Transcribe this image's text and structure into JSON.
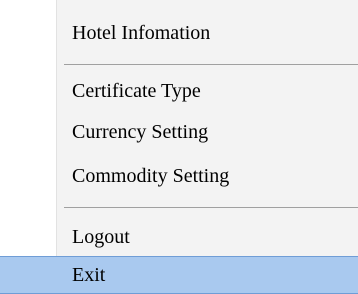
{
  "menu": {
    "items": [
      {
        "label": "Hotel Infomation"
      },
      {
        "label": "Certificate Type"
      },
      {
        "label": "Currency Setting"
      },
      {
        "label": "Commodity Setting"
      },
      {
        "label": "Logout"
      },
      {
        "label": "Exit",
        "highlighted": true
      }
    ],
    "highlight_color": "#a9c9ef"
  }
}
